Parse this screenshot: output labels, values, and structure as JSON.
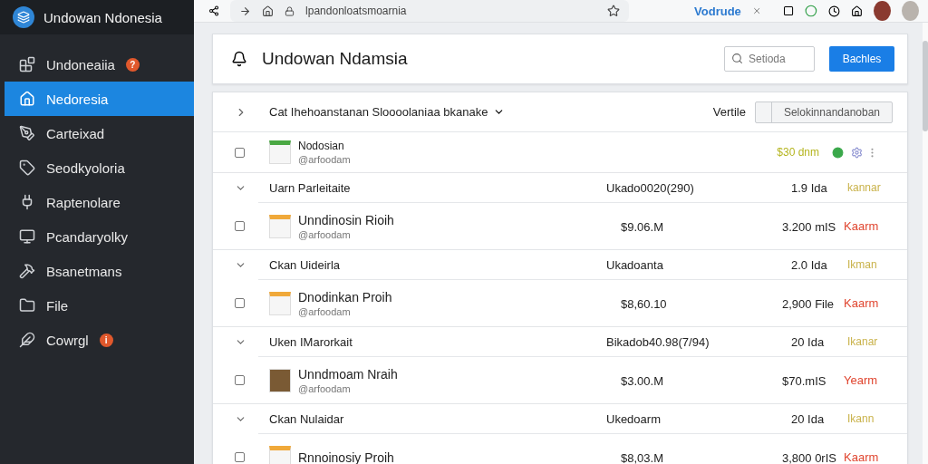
{
  "app": {
    "name": "Undowan Ndonesia"
  },
  "sidebar": {
    "items": [
      {
        "label": "Undoneaiia",
        "badge": "?",
        "selected": false,
        "kind": "blocks"
      },
      {
        "label": "Nedoresia",
        "selected": true,
        "kind": "home"
      },
      {
        "label": "Carteixad",
        "selected": false,
        "kind": "pen"
      },
      {
        "label": "Seodkyoloria",
        "selected": false,
        "kind": "tag"
      },
      {
        "label": "Raptenolare",
        "selected": false,
        "kind": "plug"
      },
      {
        "label": "Pcandaryolky",
        "selected": false,
        "kind": "monitor"
      },
      {
        "label": "Bsanetmans",
        "selected": false,
        "kind": "hammer"
      },
      {
        "label": "File",
        "selected": false,
        "kind": "folder"
      },
      {
        "label": "Cowrgl",
        "badge": "i",
        "selected": false,
        "kind": "leaf"
      }
    ]
  },
  "browser": {
    "url": "lpandonloatsmoarnia",
    "tab": "Vodrude"
  },
  "header": {
    "title": "Undowan Ndamsia",
    "search": {
      "placeholder": "Setioda"
    },
    "button": "Bachles"
  },
  "list": {
    "title": "Cat Ihehoanstanan Sloooolaniaa bkanake",
    "filter_label": "Vertile",
    "select": {
      "value": "Selokinnandanoban"
    },
    "top_item": {
      "name": "Nodosian",
      "sub": "@arfoodam",
      "amount": "$30 dnm",
      "checked": false,
      "kind": "sheet"
    },
    "groups": [
      {
        "name": "Uarn Parleitaite",
        "code": "Ukado0020(290)",
        "size": "1.9 Ida",
        "status": {
          "text": "kannar",
          "color": "#c9b24a"
        },
        "expanded": true,
        "item": {
          "name": "Unndinosin Rioih",
          "sub": "@arfoodam",
          "price": "$9.06.M",
          "size": "3.200 mIS",
          "status": {
            "text": "Kaarm",
            "color": "#e0452f"
          },
          "checked": false,
          "kind": "file"
        }
      },
      {
        "name": "Ckan Uideirla",
        "code": "Ukadoanta",
        "size": "2.0 Ida",
        "status": {
          "text": "Ikman",
          "color": "#c9b24a"
        },
        "expanded": true,
        "item": {
          "name": "Dnodinkan Proih",
          "sub": "@arfoodam",
          "price": "$8,60.10",
          "size": "2,900 File",
          "status": {
            "text": "Kaarm",
            "color": "#e0452f"
          },
          "checked": false,
          "kind": "file"
        }
      },
      {
        "name": "Uken IMarorkait",
        "code": "Bikadob40.98(7/94)",
        "size": "20 Ida",
        "status": {
          "text": "Ikanar",
          "color": "#c9b24a"
        },
        "expanded": true,
        "item": {
          "name": "Unndmoam Nraih",
          "sub": "@arfoodam",
          "price": "$3.00.M",
          "size": "$70.mIS",
          "status": {
            "text": "Yearm",
            "color": "#e0452f"
          },
          "checked": false,
          "kind": "photo"
        }
      },
      {
        "name": "Ckan Nulaidar",
        "code": "Ukedoarm",
        "size": "20 Ida",
        "status": {
          "text": "Ikann",
          "color": "#c9b24a"
        },
        "expanded": true,
        "item": {
          "name": "Rnnoinosiy Proih",
          "price": "$8,03.M",
          "size": "3,800 0rIS",
          "status": {
            "text": "Kaarm",
            "color": "#e0452f"
          },
          "checked": false,
          "kind": "file"
        }
      }
    ]
  }
}
